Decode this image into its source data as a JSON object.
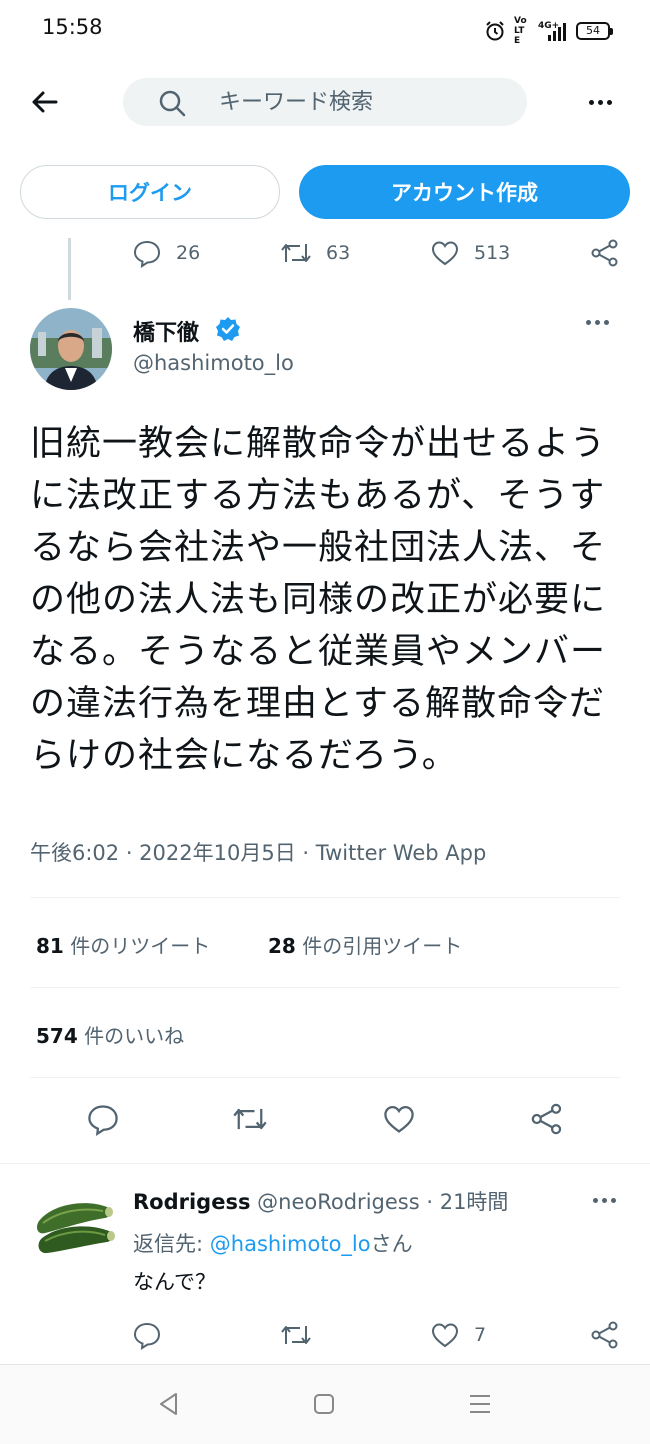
{
  "status_bar": {
    "time": "15:58",
    "volte": "Vo LTE",
    "network": "4G+",
    "battery": "54"
  },
  "header": {
    "search_placeholder": "キーワード検索"
  },
  "auth": {
    "login_label": "ログイン",
    "signup_label": "アカウント作成"
  },
  "previous_tweet_actions": {
    "replies": "26",
    "retweets": "63",
    "likes": "513"
  },
  "tweet": {
    "author_name": "橋下徹",
    "author_handle": "@hashimoto_lo",
    "text": "旧統一教会に解散命令が出せるように法改正する方法もあるが、そうするなら会社法や一般社団法人法、その他の法人法も同様の改正が必要になる。そうなると従業員やメンバーの違法行為を理由とする解散命令だらけの社会になるだろう。",
    "meta": "午後6:02 · 2022年10月5日 · Twitter Web App",
    "retweet_count": "81",
    "retweet_label": " 件のリツイート",
    "quote_count": "28",
    "quote_label": " 件の引用ツイート",
    "like_count": "574",
    "like_label": " 件のいいね"
  },
  "reply": {
    "name": "Rodrigess",
    "handle": "@neoRodrigess",
    "separator": " · ",
    "time": "21時間",
    "reply_prefix": "返信先: ",
    "reply_mention": "@hashimoto_lo",
    "reply_suffix": "さん",
    "text": "なんで？",
    "likes": "7"
  },
  "colors": {
    "accent": "#1d9bf0",
    "text": "#0f1419",
    "muted": "#536471"
  },
  "icons": [
    "back-arrow-icon",
    "search-icon",
    "more-icon",
    "reply-icon",
    "retweet-icon",
    "like-icon",
    "share-icon",
    "verified-icon",
    "nav-back-icon",
    "nav-home-icon",
    "nav-recents-icon"
  ]
}
